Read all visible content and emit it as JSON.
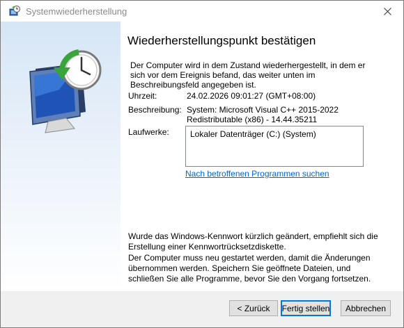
{
  "window": {
    "title": "Systemwiederherstellung"
  },
  "icons": {
    "title_icon": "system-restore-icon",
    "side_art": "system-restore-computer-clock-icon",
    "close": "close-icon"
  },
  "main": {
    "heading": "Wiederherstellungspunkt bestätigen",
    "intro": "Der Computer wird in dem Zustand wiederhergestellt, in dem er sich vor dem Ereignis befand, das weiter unten im Beschreibungsfeld angegeben ist.",
    "time_label": "Uhrzeit:",
    "time_value": "24.02.2026 09:01:27 (GMT+08:00)",
    "description_label": "Beschreibung:",
    "description_value_line1": "System: Microsoft Visual C++ 2015-2022",
    "description_value_line2": "Redistributable (x86) - 14.44.35211",
    "drives_label": "Laufwerke:",
    "drives": [
      "Lokaler Datenträger (C:) (System)"
    ],
    "scan_link": "Nach betroffenen Programmen suchen",
    "password_note": "Wurde das Windows-Kennwort kürzlich geändert, empfiehlt sich die Erstellung einer Kennwortrücksetzdiskette.",
    "restart_note": "Der Computer muss neu gestartet werden, damit die Änderungen übernommen werden. Speichern Sie geöffnete Dateien, und schließen Sie alle Programme, bevor Sie den Vorgang fortsetzen."
  },
  "buttons": {
    "back": "< Zurück",
    "finish": "Fertig stellen",
    "cancel": "Abbrechen"
  },
  "colors": {
    "link": "#0066cc",
    "accent": "#0078d7"
  }
}
